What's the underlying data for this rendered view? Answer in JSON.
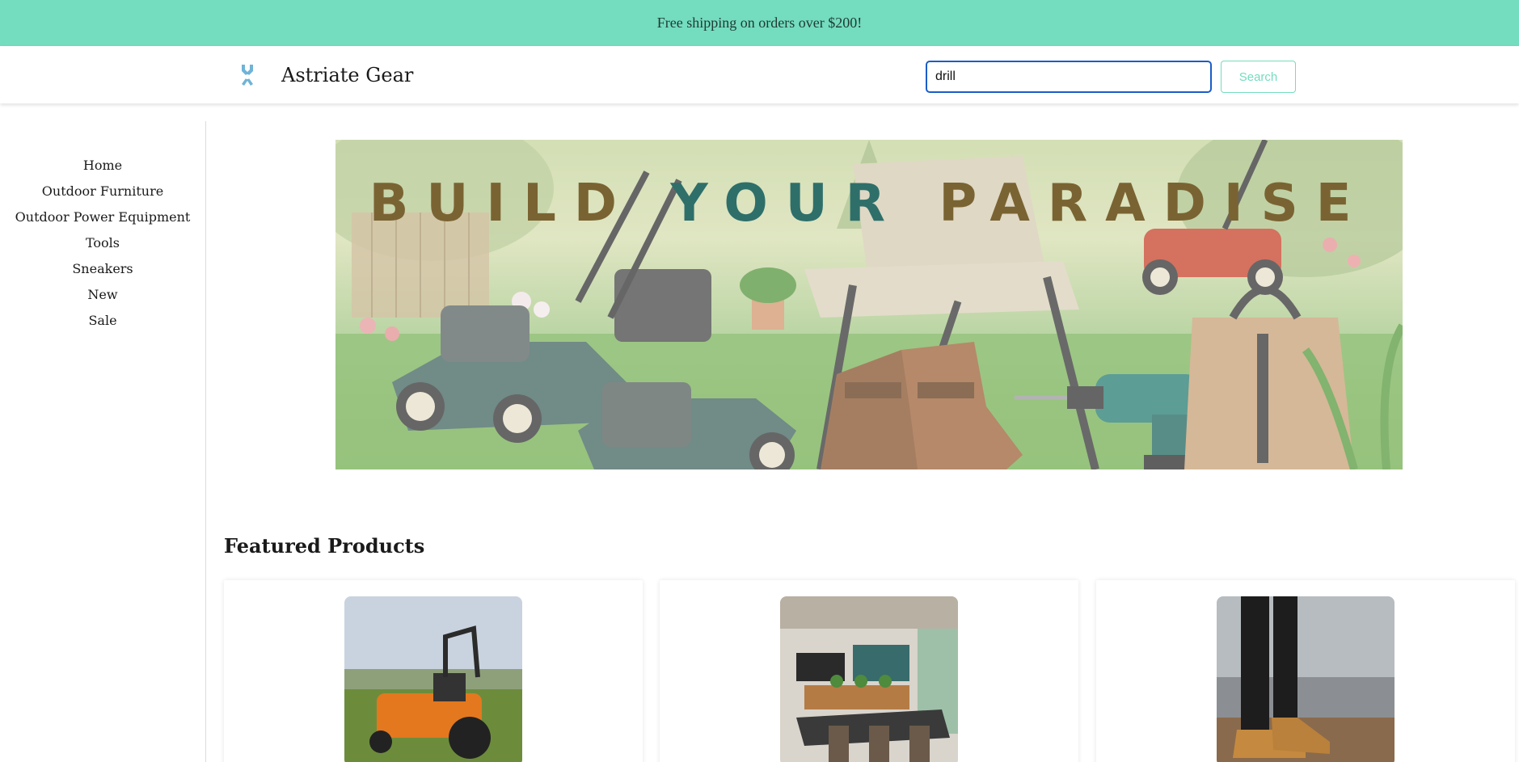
{
  "promo": {
    "text": "Free shipping on orders over $200!"
  },
  "header": {
    "brand": "Astriate Gear",
    "logo_icon": "wrench-gear-icon",
    "search": {
      "value": "drill",
      "button_label": "Search"
    }
  },
  "sidebar": {
    "items": [
      {
        "label": "Home"
      },
      {
        "label": "Outdoor Furniture"
      },
      {
        "label": "Outdoor Power Equipment"
      },
      {
        "label": "Tools"
      },
      {
        "label": "Sneakers"
      },
      {
        "label": "New"
      },
      {
        "label": "Sale"
      }
    ]
  },
  "hero": {
    "word1": "BUILD",
    "word2": "YOUR",
    "word3": "PARADISE"
  },
  "featured": {
    "title": "Featured Products",
    "products": [
      {
        "image": "orange zero-turn mower in a field"
      },
      {
        "image": "outdoor dining patio with dark table and chairs"
      },
      {
        "image": "hiker legs in black jeans with tan boots"
      }
    ]
  },
  "colors": {
    "accent": "#74dcbf",
    "search_border": "#1a5dc7",
    "hero_brown": "#7a6332",
    "hero_teal": "#2e6f6a"
  }
}
